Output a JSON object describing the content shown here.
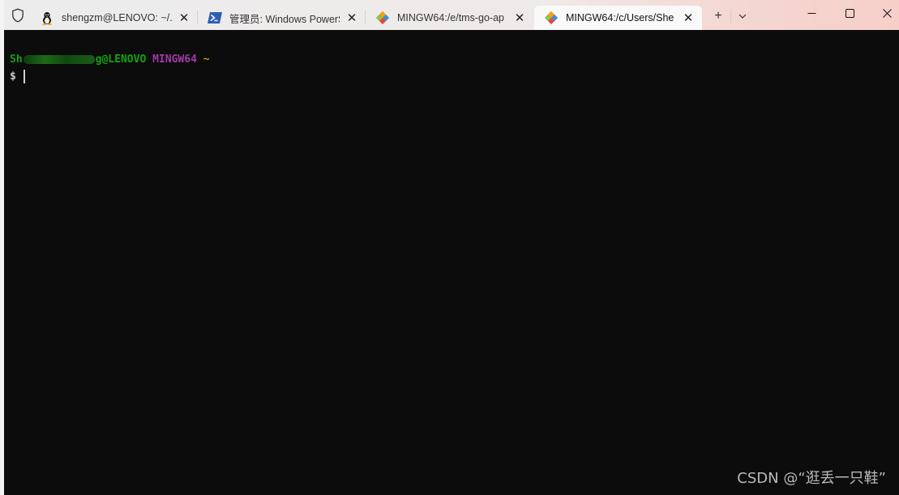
{
  "tabs": [
    {
      "title": "shengzm@LENOVO: ~/.s",
      "icon": "linux-penguin-icon",
      "active": false
    },
    {
      "title": "管理员: Windows PowerS",
      "icon": "powershell-icon",
      "active": false
    },
    {
      "title": "MINGW64:/e/tms-go-ap",
      "icon": "git-icon",
      "active": false
    },
    {
      "title": "MINGW64:/c/Users/She",
      "icon": "git-icon",
      "active": true
    }
  ],
  "titlebar": {
    "new_tab_symbol": "+",
    "dropdown_symbol": "⌄"
  },
  "terminal": {
    "prompt_user_visible": "Sh",
    "prompt_host": "g@LENOVO",
    "prompt_system": "MINGW64",
    "prompt_dir": "~",
    "prompt_symbol": "$"
  },
  "watermark": "CSDN @“逛丢一只鞋”",
  "colors": {
    "prompt_user": "#13a10e",
    "prompt_system": "#a13aa8",
    "prompt_dir": "#c19c00",
    "background": "#0c0c0c"
  }
}
